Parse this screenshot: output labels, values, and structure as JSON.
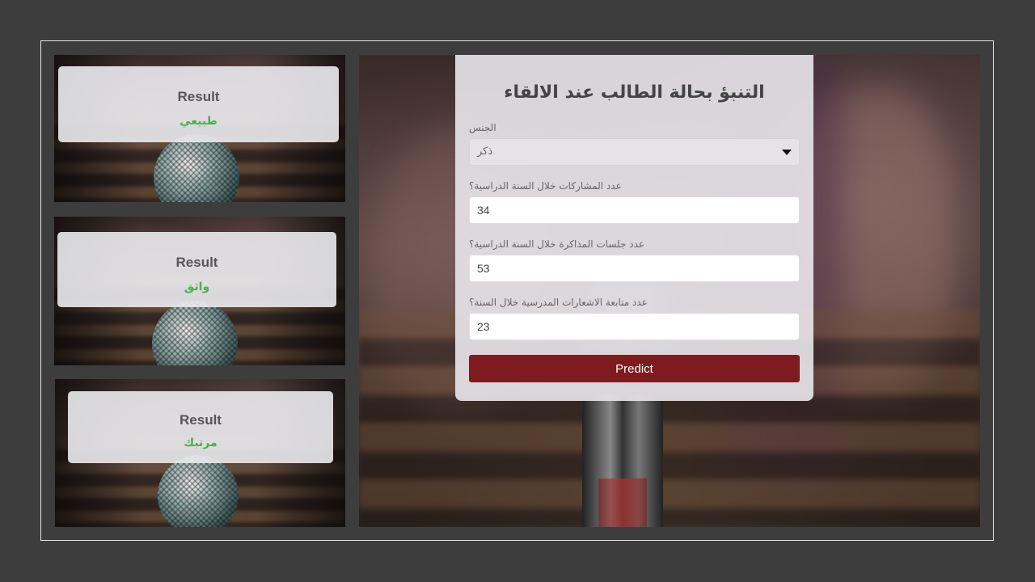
{
  "results": [
    {
      "title": "Result",
      "value": "طبيعي"
    },
    {
      "title": "Result",
      "value": "واثق"
    },
    {
      "title": "Result",
      "value": "مرتبك"
    }
  ],
  "form": {
    "title": "التنبؤ بحالة الطالب عند الالقاء",
    "gender": {
      "label": "الجنس",
      "selected": "ذكر"
    },
    "participations": {
      "label": "عدد المشاركات خلال السنة الدراسية؟",
      "value": "34"
    },
    "study_sessions": {
      "label": "عدد جلسات المذاكرة خلال السنة الدراسية؟",
      "value": "53"
    },
    "notifications": {
      "label": "عدد متابعة الاشعارات المدرسية خلال السنة؟",
      "value": "23"
    },
    "submit_label": "Predict"
  },
  "colors": {
    "page_bg": "#3d3d3d",
    "button": "#7d1b1e",
    "result_value": "#4caf50"
  }
}
